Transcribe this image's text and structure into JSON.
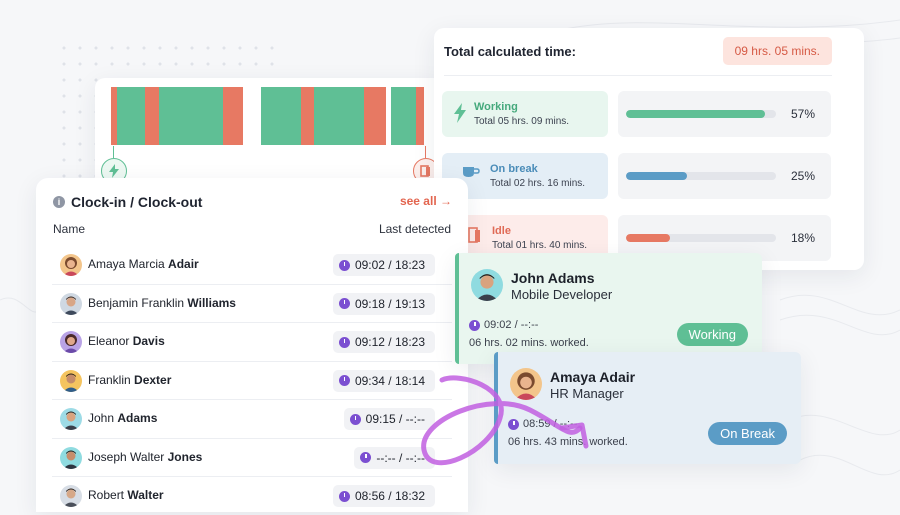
{
  "summary": {
    "title": "Total calculated time:",
    "total": "09 hrs. 05 mins.",
    "stats": [
      {
        "label": "Working",
        "sub": "Total 05 hrs. 09 mins.",
        "percent_text": "57%",
        "fraction": 0.57,
        "color": "#5fbf95",
        "bg": "#e8f6ef",
        "icon": "bolt-icon"
      },
      {
        "label": "On break",
        "sub": "Total 02 hrs. 16 mins.",
        "percent_text": "25%",
        "fraction": 0.25,
        "color": "#5b9cc6",
        "bg": "#e4eef6",
        "icon": "coffee-icon"
      },
      {
        "label": "Idle",
        "sub": "Total 01 hrs. 40 mins.",
        "percent_text": "18%",
        "fraction": 0.18,
        "color": "#e77963",
        "bg": "#fdecea",
        "icon": "door-icon"
      }
    ]
  },
  "clock": {
    "title": "Clock-in / Clock-out",
    "see_all": "see all",
    "col_name": "Name",
    "col_detected": "Last detected",
    "rows": [
      {
        "first": "Amaya Marcia",
        "last": "Adair",
        "time": "09:02 / 18:23"
      },
      {
        "first": "Benjamin Franklin",
        "last": "Williams",
        "time": "09:18 / 19:13"
      },
      {
        "first": "Eleanor",
        "last": "Davis",
        "time": "09:12 / 18:23"
      },
      {
        "first": "Franklin",
        "last": "Dexter",
        "time": "09:34 / 18:14"
      },
      {
        "first": "John",
        "last": "Adams",
        "time": "09:15 / --:--"
      },
      {
        "first": "Joseph Walter",
        "last": "Jones",
        "time": "--:-- / --:--"
      },
      {
        "first": "Robert",
        "last": "Walter",
        "time": "08:56 / 18:32"
      }
    ]
  },
  "john": {
    "name": "John Adams",
    "role": "Mobile Developer",
    "time": "09:02 / --:--",
    "worked": "06 hrs. 02 mins. worked.",
    "status": "Working"
  },
  "amaya": {
    "name": "Amaya Adair",
    "role": "HR Manager",
    "time": "08:59 / --:--",
    "worked": "06 hrs. 43 mins. worked.",
    "status": "On Break"
  },
  "colors": {
    "working": "#5fbf95",
    "break": "#5b9cc6",
    "idle": "#e77963",
    "accent_purple": "#7b4fd1"
  }
}
